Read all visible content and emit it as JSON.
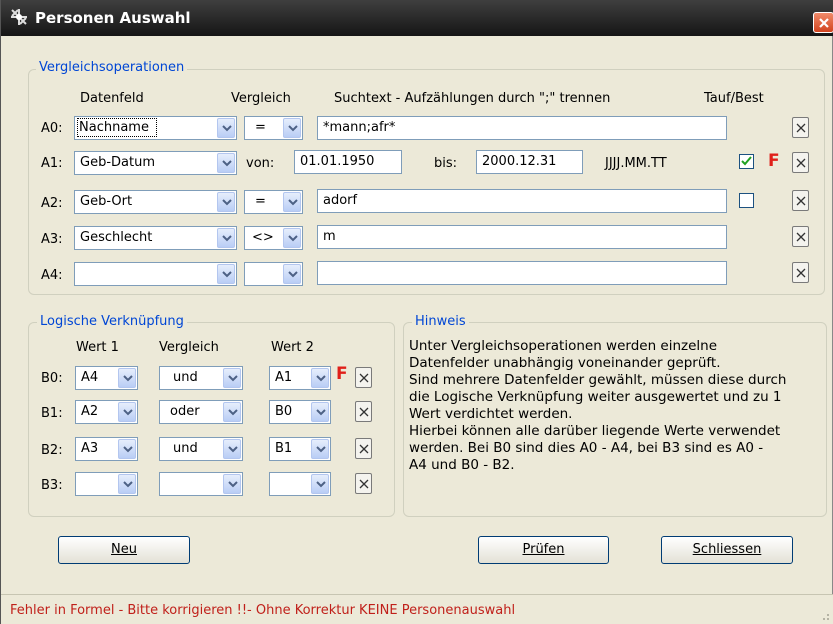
{
  "window": {
    "title": "Personen Auswahl"
  },
  "vergleich": {
    "group_title": "Vergleichsoperationen",
    "headers": {
      "datenfeld": "Datenfeld",
      "vergleich": "Vergleich",
      "suchtext": "Suchtext - Aufzählungen durch \";\" trennen",
      "tauf": "Tauf/Best"
    },
    "rows": [
      {
        "label": "A0:",
        "field": "Nachname",
        "op": "=",
        "text": "*mann;afr*",
        "checked": false
      },
      {
        "label": "A1:",
        "field": "Geb-Datum",
        "von_label": "von:",
        "von": "01.01.1950",
        "bis_label": "bis:",
        "bis": "2000.12.31",
        "format": "JJJJ.MM.TT",
        "checked": true,
        "error": "F"
      },
      {
        "label": "A2:",
        "field": "Geb-Ort",
        "op": "=",
        "text": "adorf",
        "checked": false
      },
      {
        "label": "A3:",
        "field": "Geschlecht",
        "op": "<>",
        "text": "m"
      },
      {
        "label": "A4:",
        "field": "",
        "op": "",
        "text": ""
      }
    ]
  },
  "logic": {
    "group_title": "Logische Verknüpfung",
    "headers": {
      "wert1": "Wert 1",
      "vergleich": "Vergleich",
      "wert2": "Wert 2"
    },
    "rows": [
      {
        "label": "B0:",
        "w1": "A4",
        "op": "und",
        "w2": "A1",
        "error": "F"
      },
      {
        "label": "B1:",
        "w1": "A2",
        "op": "oder",
        "w2": "B0"
      },
      {
        "label": "B2:",
        "w1": "A3",
        "op": "und",
        "w2": "B1"
      },
      {
        "label": "B3:",
        "w1": "",
        "op": "",
        "w2": ""
      }
    ]
  },
  "hinweis": {
    "group_title": "Hinweis",
    "lines": [
      "Unter Vergleichsoperationen werden einzelne",
      "Datenfelder unabhängig voneinander geprüft.",
      "Sind mehrere Datenfelder gewählt, müssen diese durch",
      "die Logische Verknüpfung weiter ausgewertet und zu 1",
      "Wert verdichtet werden.",
      "Hierbei können alle darüber liegende Werte verwendet",
      "werden. Bei B0 sind dies A0 - A4, bei B3 sind es A0 -",
      "A4 und B0 - B2."
    ]
  },
  "buttons": {
    "neu": "Neu",
    "pruefen": "Prüfen",
    "schliessen": "Schliessen"
  },
  "status": {
    "message": "Fehler in Formel -  Bitte korrigieren !!- Ohne Korrektur KEINE Personenauswahl"
  },
  "colors": {
    "error_red": "#e0201a",
    "group_title_blue": "#0046d5",
    "window_bg": "#ece9d8"
  }
}
